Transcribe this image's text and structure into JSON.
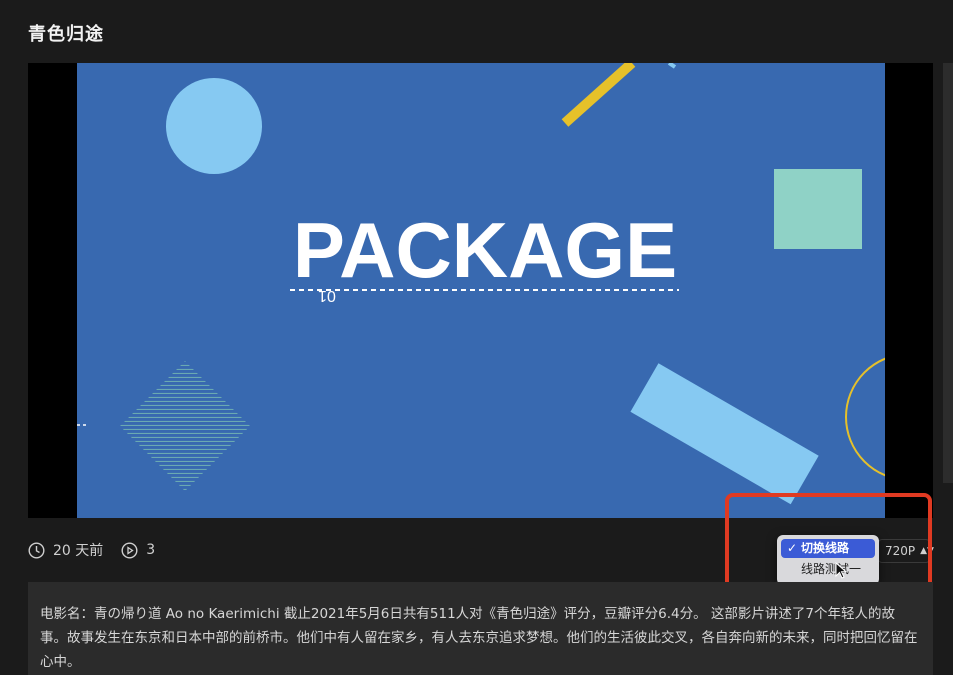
{
  "page": {
    "title": "青色归途"
  },
  "video": {
    "headline": "PACKAGE",
    "subtext": "01",
    "colors": {
      "background": "#3869b0",
      "circle": "#86c9f2",
      "yellow_bar": "#e6c12a",
      "teal_square": "#8fd2c6",
      "hatch": "#7ec4b2",
      "rect": "#86c9f2"
    }
  },
  "meta": {
    "time_icon": "clock-icon",
    "time_ago": "20 天前",
    "play_icon": "play-circle-icon",
    "play_count": "3"
  },
  "route_menu": {
    "options": [
      {
        "label": "切换线路",
        "selected": true,
        "check": "✓"
      },
      {
        "label": "线路测试一",
        "selected": false
      }
    ]
  },
  "quality": {
    "value": "720P",
    "arrows": "▲▼"
  },
  "description": {
    "text": "电影名：青の帰り道 Ao no Kaerimichi 截止2021年5月6日共有511人对《青色归途》评分，豆瓣评分6.4分。 这部影片讲述了7个年轻人的故事。故事发生在东京和日本中部的前桥市。他们中有人留在家乡，有人去东京追求梦想。他们的生活彼此交叉，各自奔向新的未来，同时把回忆留在心中。"
  },
  "accent_colors": {
    "highlight_border": "#e03a22",
    "menu_selected": "#3b5bd6"
  }
}
